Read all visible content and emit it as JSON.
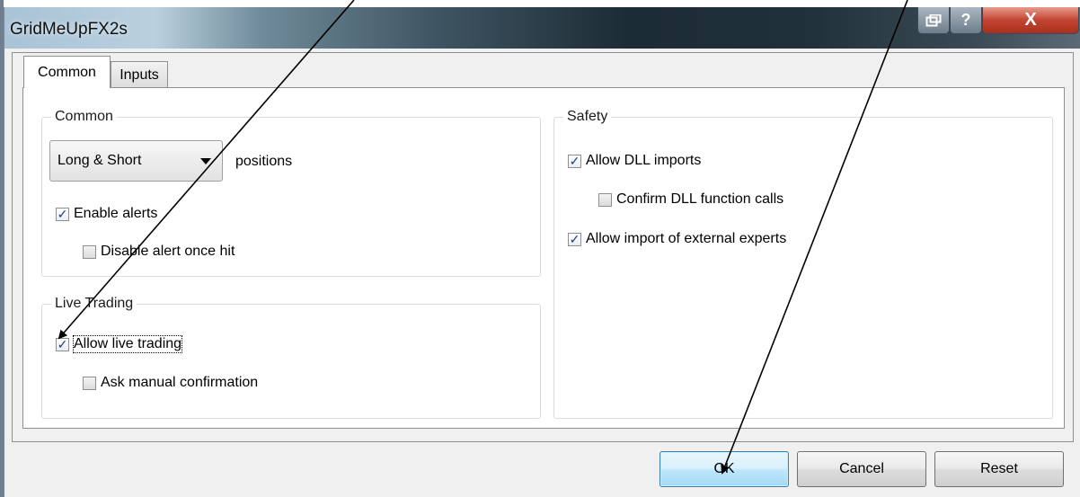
{
  "window": {
    "title": "GridMeUpFX2s",
    "close_glyph": "X",
    "help_glyph": "?"
  },
  "tabs": [
    {
      "label": "Common",
      "selected": true
    },
    {
      "label": "Inputs",
      "selected": false
    }
  ],
  "common_group": {
    "legend": "Common",
    "positions_select": {
      "value": "Long & Short"
    },
    "positions_label": "positions",
    "enable_alerts": {
      "label": "Enable alerts",
      "checked": true
    },
    "disable_alert_once_hit": {
      "label": "Disable alert once hit",
      "checked": false
    }
  },
  "live_trading_group": {
    "legend": "Live Trading",
    "allow_live_trading": {
      "label": "Allow live trading",
      "checked": true
    },
    "ask_manual_confirmation": {
      "label": "Ask manual confirmation",
      "checked": false
    }
  },
  "safety_group": {
    "legend": "Safety",
    "allow_dll_imports": {
      "label": "Allow DLL imports",
      "checked": true
    },
    "confirm_dll_function_calls": {
      "label": "Confirm DLL function calls",
      "checked": false
    },
    "allow_import_external_experts": {
      "label": "Allow import of external experts",
      "checked": true
    }
  },
  "buttons": {
    "ok": "OK",
    "cancel": "Cancel",
    "reset": "Reset"
  },
  "colors": {
    "arrow": "#000000",
    "checkmark": "#1f3f7a",
    "ok_border": "#3c7fb1"
  }
}
